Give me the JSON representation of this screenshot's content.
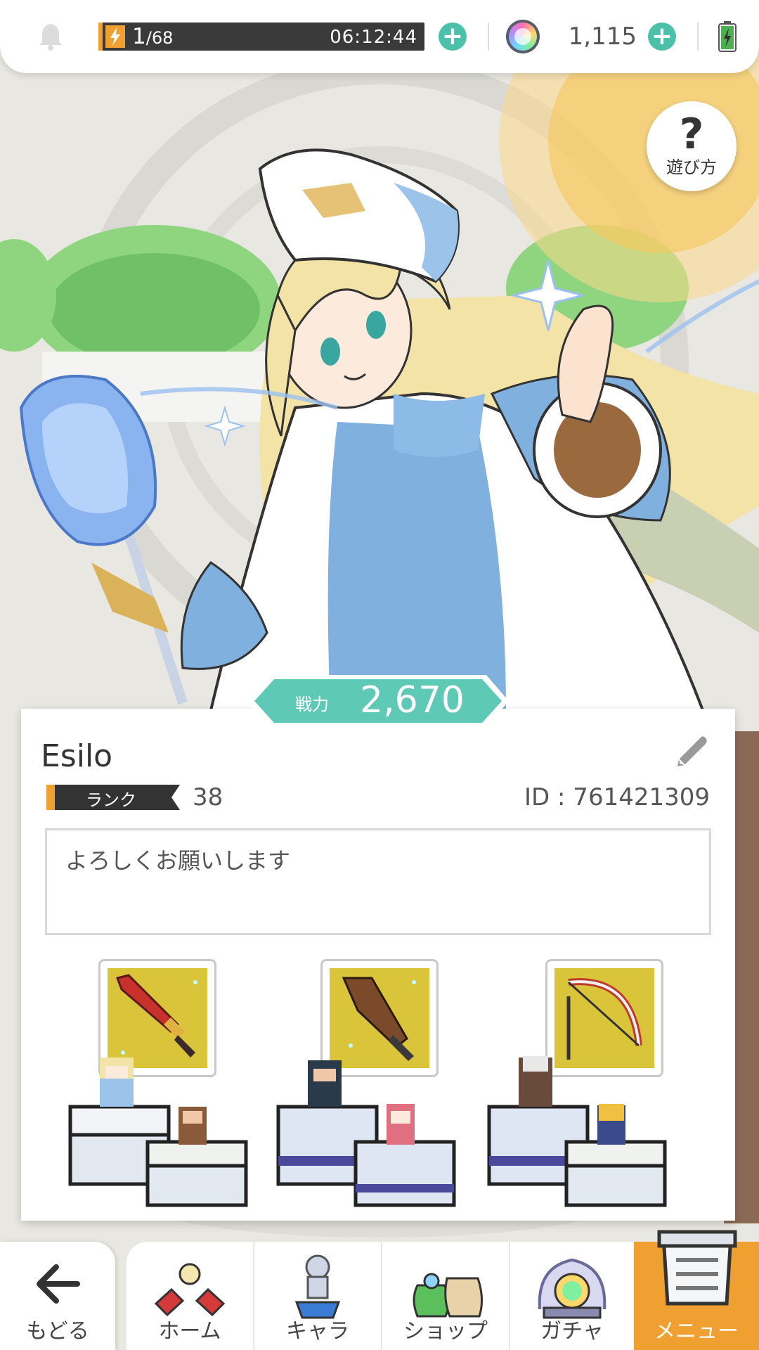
{
  "topbar": {
    "stamina_current": "1",
    "stamina_max": "/68",
    "stamina_timer": "06:12:44",
    "gem_count": "1,115"
  },
  "help": {
    "label": "遊び方"
  },
  "profile": {
    "power_label": "戦力",
    "power_value": "2,670",
    "name": "Esilo",
    "rank_label": "ランク",
    "rank_value": "38",
    "id_text": "ID : 761421309",
    "message": "よろしくお願いします"
  },
  "teams": [
    {
      "weapon": "sword-icon",
      "weapon_color": "#c8302a"
    },
    {
      "weapon": "blade-icon",
      "weapon_color": "#7a4a2a"
    },
    {
      "weapon": "bow-icon",
      "weapon_color": "#c03a2a"
    }
  ],
  "nav": {
    "back": "もどる",
    "home": "ホーム",
    "chara": "キャラ",
    "shop": "ショップ",
    "gacha": "ガチャ",
    "menu": "メニュー"
  },
  "colors": {
    "accent": "#4cc1aa",
    "active_tab": "#f0a030",
    "power_banner": "#5ec9b5"
  }
}
